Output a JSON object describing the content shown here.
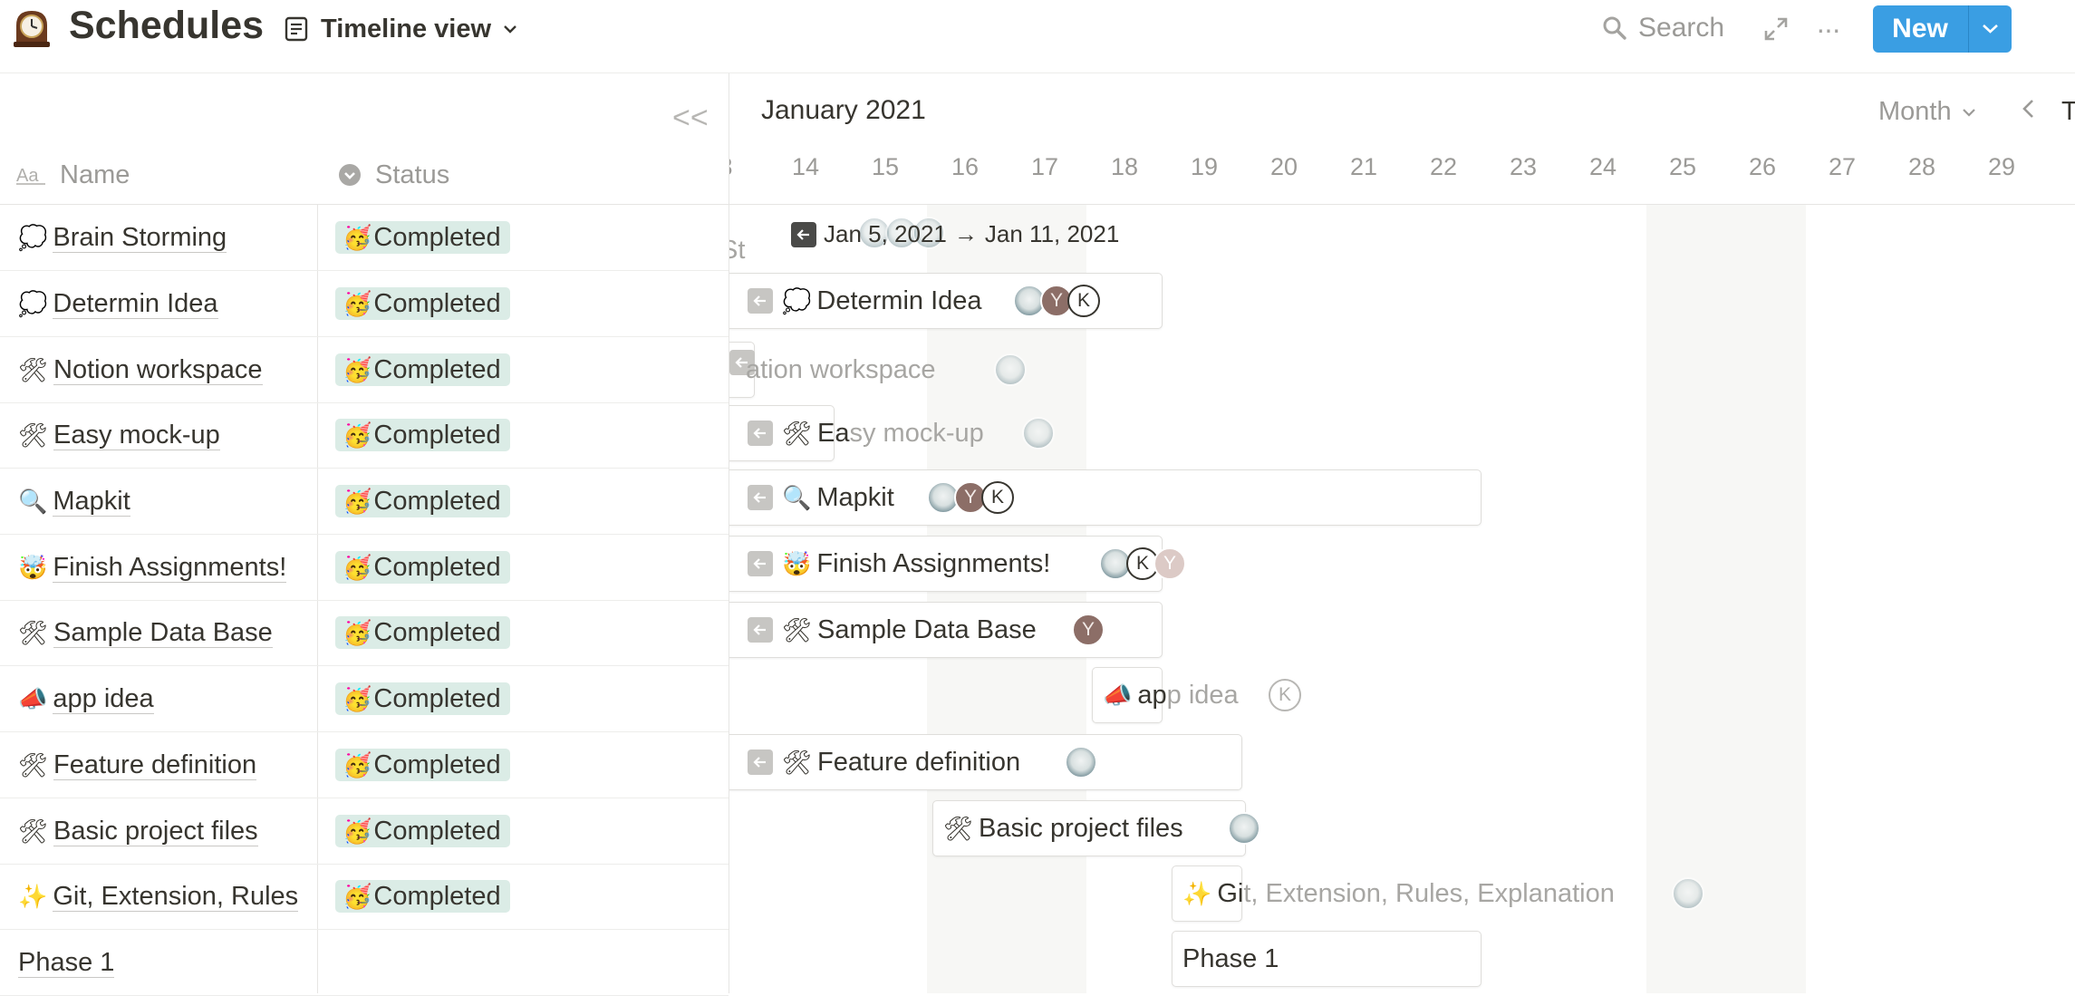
{
  "header": {
    "page_title": "Schedules",
    "page_icon": "mantel-clock-icon",
    "view_name": "Timeline view",
    "search_label": "Search",
    "more_label": "···",
    "new_label": "New"
  },
  "table": {
    "name_header": "Name",
    "status_header": "Status",
    "collapse_label": "<<",
    "rows": [
      {
        "emoji": "💭",
        "name": "Brain Storming",
        "status_emoji": "🥳",
        "status": "Completed"
      },
      {
        "emoji": "💭",
        "name": "Determin Idea",
        "status_emoji": "🥳",
        "status": "Completed"
      },
      {
        "emoji": "🛠",
        "name": "Notion workspace",
        "status_emoji": "🥳",
        "status": "Completed"
      },
      {
        "emoji": "🛠",
        "name": "Easy mock-up",
        "status_emoji": "🥳",
        "status": "Completed"
      },
      {
        "emoji": "🔍",
        "name": "Mapkit",
        "status_emoji": "🥳",
        "status": "Completed"
      },
      {
        "emoji": "🤯",
        "name": "Finish Assignments!",
        "status_emoji": "🥳",
        "status": "Completed"
      },
      {
        "emoji": "🛠",
        "name": "Sample Data Base",
        "status_emoji": "🥳",
        "status": "Completed"
      },
      {
        "emoji": "📣",
        "name": "app idea",
        "status_emoji": "🥳",
        "status": "Completed"
      },
      {
        "emoji": "🛠",
        "name": "Feature definition",
        "status_emoji": "🥳",
        "status": "Completed"
      },
      {
        "emoji": "🛠",
        "name": "Basic project files",
        "status_emoji": "🥳",
        "status": "Completed"
      },
      {
        "emoji": "✨",
        "name": "Git, Extension, Rules",
        "status_emoji": "🥳",
        "status": "Completed"
      },
      {
        "emoji": "",
        "name": "Phase 1",
        "status_emoji": "",
        "status": ""
      }
    ]
  },
  "timeline": {
    "month_label": "January 2021",
    "scale_label": "Month",
    "today_label": "T",
    "days": [
      "3",
      "14",
      "15",
      "16",
      "17",
      "18",
      "19",
      "20",
      "21",
      "22",
      "23",
      "24",
      "25",
      "26",
      "27",
      "28",
      "29",
      "3"
    ],
    "date_range": {
      "start": "Jan 5, 2021",
      "arrow": "→",
      "end": "Jan 11, 2021"
    },
    "bars": [
      {
        "label": "Brain Storming",
        "emoji": "",
        "visible_text": "St"
      },
      {
        "label": "Determin Idea",
        "emoji": "💭",
        "avatars": [
          "G",
          "Y",
          "K"
        ]
      },
      {
        "label": "Notion workspace",
        "emoji": "",
        "visible_text": "ation workspace",
        "avatars": [
          "G"
        ]
      },
      {
        "label": "Easy mock-up",
        "emoji": "🛠",
        "visible_text_a": "Ea",
        "visible_text_b": "sy mock-up",
        "avatars": [
          "G"
        ]
      },
      {
        "label": "Mapkit",
        "emoji": "🔍",
        "avatars": [
          "G",
          "Y",
          "K"
        ]
      },
      {
        "label": "Finish Assignments!",
        "emoji": "🤯",
        "avatars": [
          "G",
          "K",
          "Y"
        ]
      },
      {
        "label": "Sample Data Base",
        "emoji": "🛠",
        "avatars": [
          "Y"
        ]
      },
      {
        "label": "app idea",
        "emoji": "📣",
        "visible_text_a": "ap",
        "visible_text_b": "p idea",
        "avatars": [
          "K"
        ]
      },
      {
        "label": "Feature definition",
        "emoji": "🛠",
        "avatars": [
          "G"
        ]
      },
      {
        "label": "Basic project files",
        "emoji": "🛠",
        "avatars": [
          "G"
        ]
      },
      {
        "label": "Git, Extension, Rules, Explanation",
        "emoji": "✨",
        "visible_text_a": "Gi",
        "visible_text_b": "t, Extension, Rules, Explanation",
        "avatars": [
          "G"
        ]
      },
      {
        "label": "Phase 1",
        "emoji": ""
      }
    ]
  },
  "colors": {
    "accent": "#3a9ee3",
    "status_bg": "#dbece6",
    "weekend_bg": "#f7f7f5",
    "text": "#37352f",
    "muted": "#9b9a97"
  }
}
